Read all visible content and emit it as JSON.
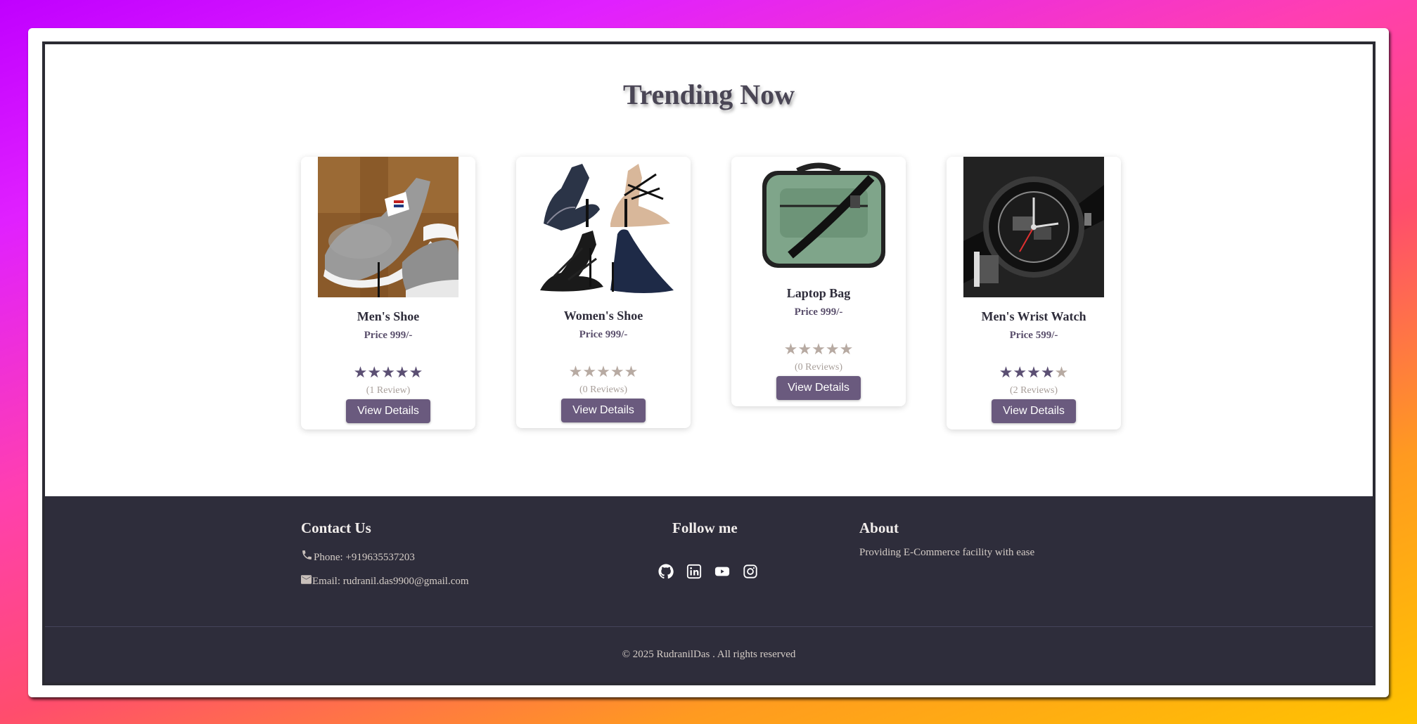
{
  "section_title": "Trending Now",
  "products": [
    {
      "name": "Men's Shoe",
      "price": "Price 999/-",
      "rating": 5,
      "reviews": "(1 Review)",
      "button": "View Details",
      "image": "mens-shoe-image"
    },
    {
      "name": "Women's Shoe",
      "price": "Price 999/-",
      "rating": 0,
      "reviews": "(0 Reviews)",
      "button": "View Details",
      "image": "womens-shoe-image"
    },
    {
      "name": "Laptop Bag",
      "price": "Price 999/-",
      "rating": 0,
      "reviews": "(0 Reviews)",
      "button": "View Details",
      "image": "laptop-bag-image"
    },
    {
      "name": "Men's Wrist Watch",
      "price": "Price 599/-",
      "rating": 4,
      "reviews": "(2 Reviews)",
      "button": "View Details",
      "image": "wrist-watch-image"
    }
  ],
  "footer": {
    "contact": {
      "title": "Contact Us",
      "phone": "Phone: +919635537203",
      "email": "Email: rudranil.das9900@gmail.com"
    },
    "follow": {
      "title": "Follow me",
      "icons": [
        "github-icon",
        "linkedin-icon",
        "youtube-icon",
        "instagram-icon"
      ]
    },
    "about": {
      "title": "About",
      "text": "Providing E-Commerce facility with ease"
    },
    "copyright": "© 2025 RudranilDas . All rights reserved"
  },
  "colors": {
    "accent": "#6a5a7e",
    "footer_bg": "#2e2d3b",
    "star_filled": "#5b4f73",
    "star_empty": "#b7aaa2"
  }
}
